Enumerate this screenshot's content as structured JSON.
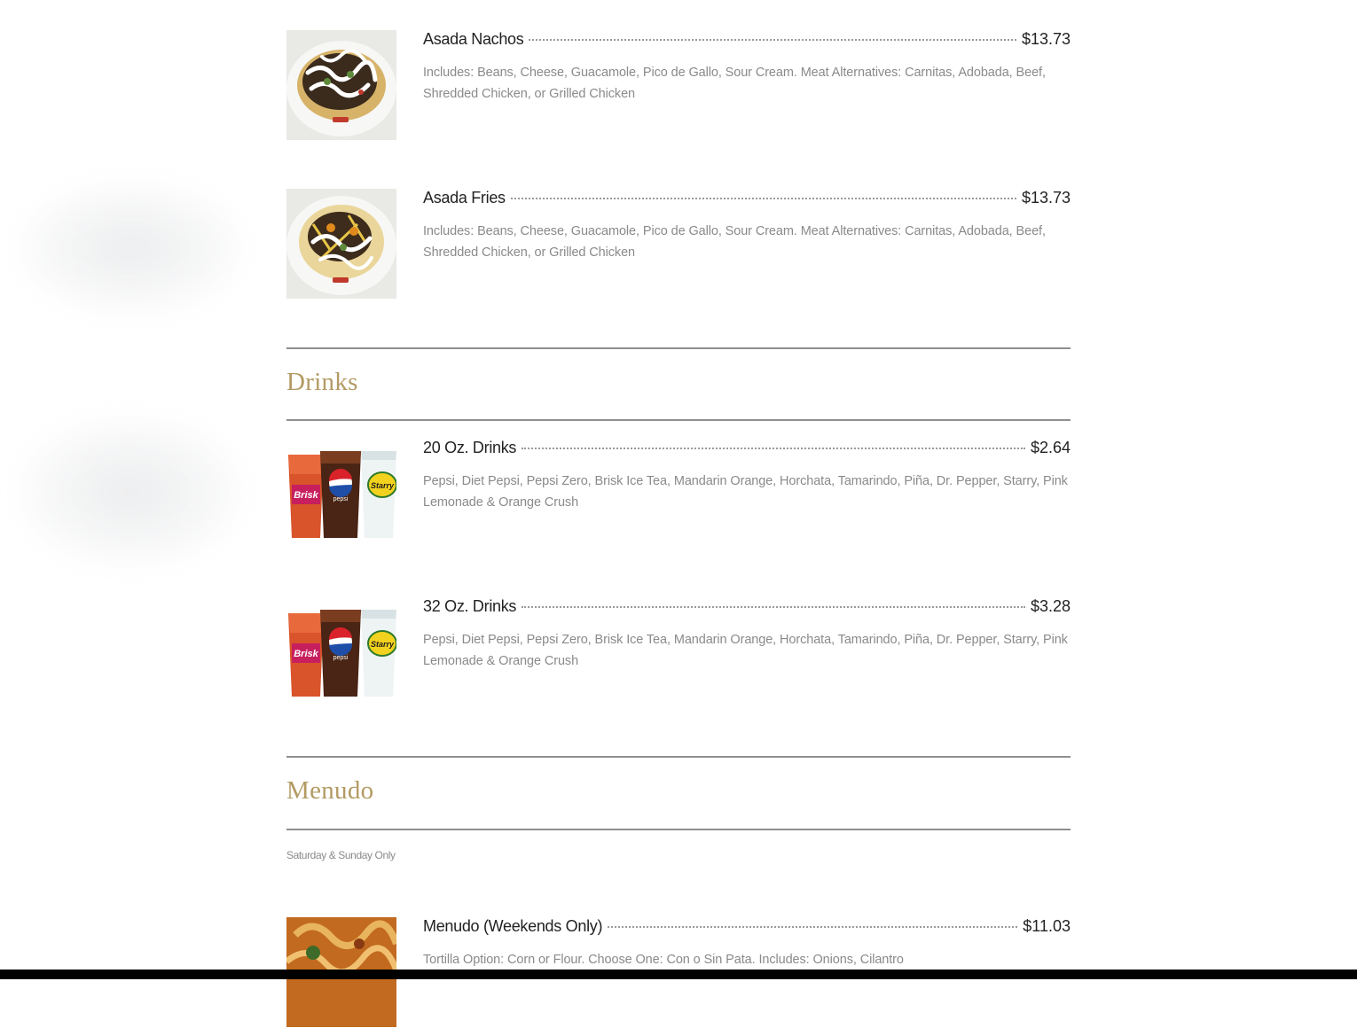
{
  "sections": {
    "nachos": {
      "items": [
        {
          "name": "Asada Nachos",
          "price": "$13.73",
          "description": "Includes: Beans, Cheese, Guacamole, Pico de Gallo, Sour Cream. Meat Alternatives: Carnitas, Adobada, Beef, Shredded Chicken, or Grilled Chicken",
          "image_icon": "nachos-plate-photo"
        },
        {
          "name": "Asada Fries",
          "price": "$13.73",
          "description": "Includes: Beans, Cheese, Guacamole, Pico de Gallo, Sour Cream. Meat Alternatives: Carnitas, Adobada, Beef, Shredded Chicken, or Grilled Chicken",
          "image_icon": "fries-plate-photo"
        }
      ]
    },
    "drinks": {
      "title": "Drinks",
      "items": [
        {
          "name": "20 Oz. Drinks",
          "price": "$2.64",
          "description": "Pepsi, Diet Pepsi, Pepsi Zero, Brisk Ice Tea, Mandarin Orange, Horchata, Tamarindo, Piña, Dr. Pepper, Starry, Pink Lemonade & Orange Crush",
          "image_icon": "drink-cups-photo"
        },
        {
          "name": "32 Oz. Drinks",
          "price": "$3.28",
          "description": "Pepsi, Diet Pepsi, Pepsi Zero, Brisk Ice Tea, Mandarin Orange, Horchata, Tamarindo, Piña, Dr. Pepper, Starry, Pink Lemonade & Orange Crush",
          "image_icon": "drink-cups-photo"
        }
      ]
    },
    "menudo": {
      "title": "Menudo",
      "note": "Saturday & Sunday Only",
      "items": [
        {
          "name": "Menudo (Weekends Only)",
          "price": "$11.03",
          "description": "Tortilla Option: Corn or Flour. Choose One: Con o Sin Pata. Includes: Onions, Cilantro",
          "image_icon": "menudo-bowl-photo"
        }
      ]
    }
  },
  "colors": {
    "section_title": "#b39a63",
    "rule": "#8f8f8f",
    "description": "#8a8a8a",
    "text": "#222222"
  }
}
